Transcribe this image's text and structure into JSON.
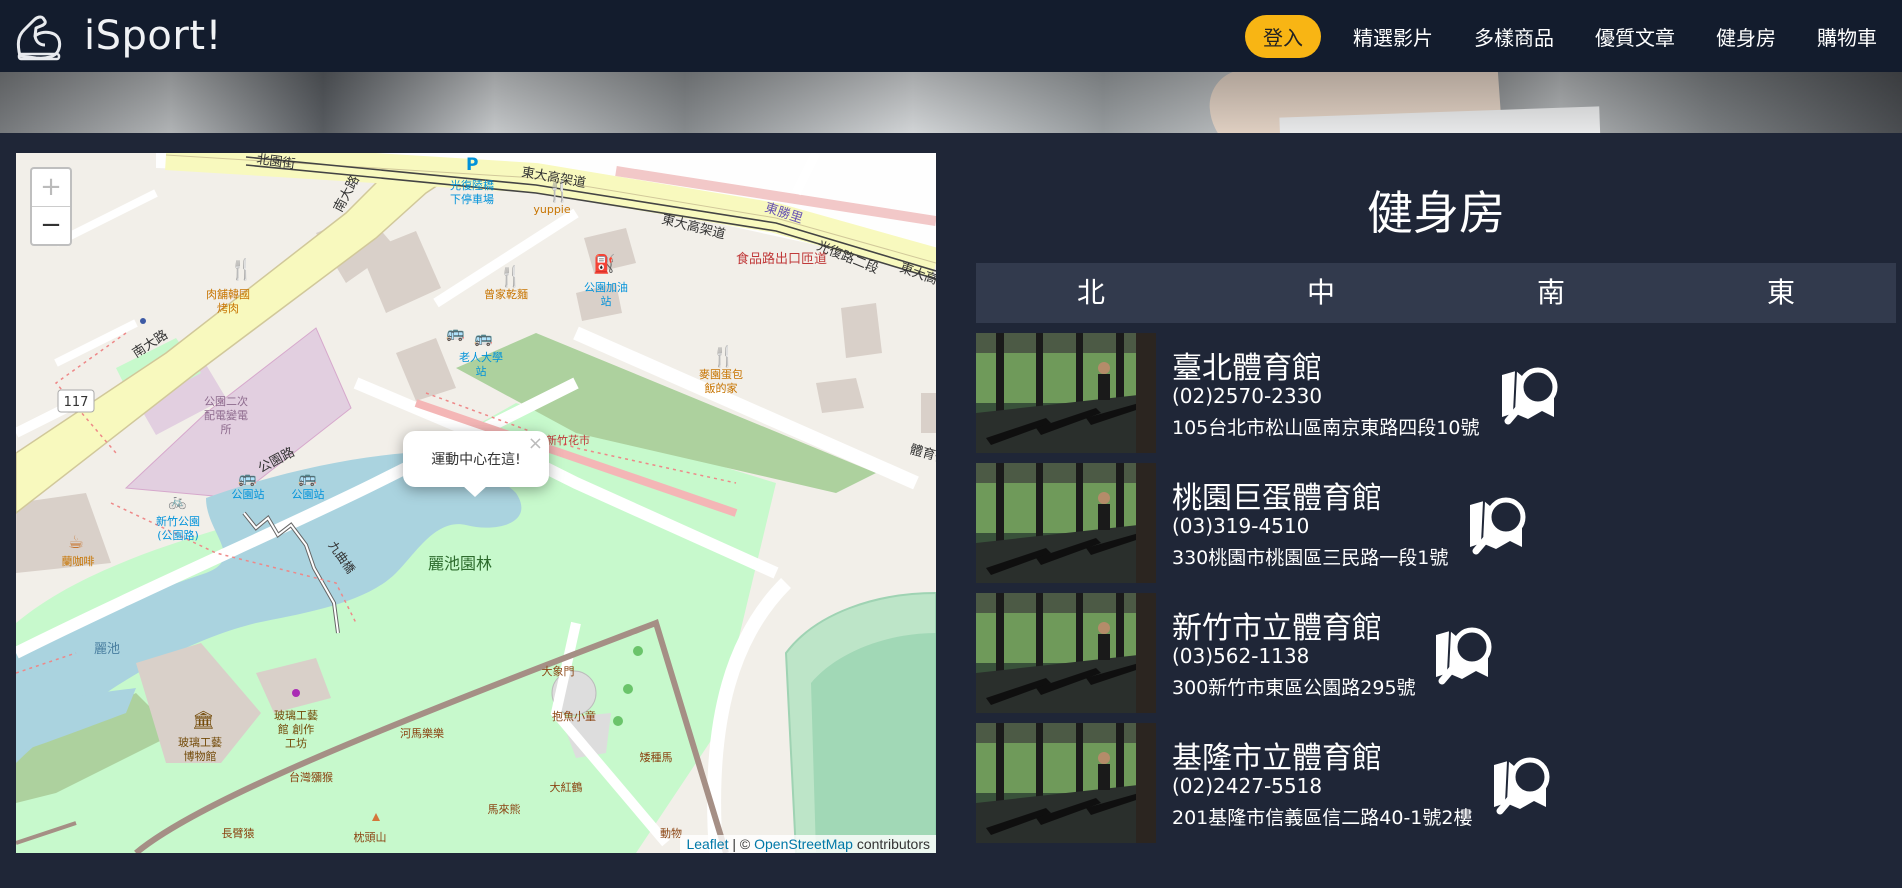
{
  "brand": {
    "name": "iSport!"
  },
  "nav": {
    "login": "登入",
    "items": [
      "精選影片",
      "多樣商品",
      "優質文章",
      "健身房",
      "購物車"
    ]
  },
  "map": {
    "zoom_in": "+",
    "zoom_out": "−",
    "popup": {
      "text": "運動中心在這!",
      "close": "×"
    },
    "attribution": {
      "leaflet": "Leaflet",
      "sep": " | © ",
      "osm": "OpenStreetMap",
      "suffix": " contributors"
    },
    "labels": {
      "road_top": "北園街",
      "elevated": "東大高架道",
      "elevated2": "東大高架道",
      "elevated3": "東大高",
      "nanda_v": "南大路",
      "nanda": "南大路",
      "route": "117",
      "parking1": "光復陸橋",
      "parking2": "下停車場",
      "yuppie": "yuppie",
      "food_exit": "食品路出口匝道",
      "guangfu": "光復路二段",
      "dongtu": "東勝里",
      "korean1": "肉舖韓國",
      "korean2": "烤肉",
      "dumpling": "曾家乾麵",
      "gas1": "公園加油",
      "gas2": "站",
      "senior1": "老人大學",
      "senior2": "站",
      "bakery1": "麥園蛋包",
      "bakery2": "飯的家",
      "power1": "公園二次",
      "power2": "配電變電",
      "power3": "所",
      "gongyuan_rd": "公園路",
      "bus1": "公園站",
      "bus2": "公園站",
      "hsinchu_park1": "新竹公園",
      "hsinchu_park2": "(公園路)",
      "coffee": "蘭咖啡",
      "nine_bridge": "九曲橋",
      "garden": "麗池園林",
      "huazhu": "新竹花市",
      "lichi": "麗池",
      "glass1": "玻璃工藝",
      "glass2": "博物館",
      "glass3": "玻璃工藝",
      "glass4": "館 創作",
      "glass5": "工坊",
      "elephant_gate": "大象門",
      "fish": "抱魚小童",
      "hippo": "河馬樂樂",
      "zebra": "矮種馬",
      "baboon": "台灣獼猴",
      "flamingo": "大紅鶴",
      "horse": "馬來熊",
      "long_arm": "長臂猿",
      "zoo": "動物",
      "pillow": "枕頭山",
      "gym_road": "體育街",
      "shipu": "食品路"
    }
  },
  "section": {
    "title": "健身房"
  },
  "regions": [
    "北",
    "中",
    "南",
    "東"
  ],
  "gyms": [
    {
      "name": "臺北體育館",
      "phone": "(02)2570-2330",
      "address": "105台北市松山區南京東路四段10號"
    },
    {
      "name": "桃園巨蛋體育館",
      "phone": "(03)319-4510",
      "address": "330桃園市桃園區三民路一段1號"
    },
    {
      "name": "新竹市立體育館",
      "phone": "(03)562-1138",
      "address": "300新竹市東區公園路295號"
    },
    {
      "name": "基隆市立體育館",
      "phone": "(02)2427-5518",
      "address": "201基隆市信義區信二路40-1號2樓"
    }
  ],
  "icons": {
    "logo": "flexed-arm-icon",
    "search": "map-search-icon"
  },
  "colors": {
    "header_bg": "#131c2d",
    "page_bg": "#1f2637",
    "tab_bar_bg": "#323a4d",
    "login_bg": "#f8b514"
  }
}
